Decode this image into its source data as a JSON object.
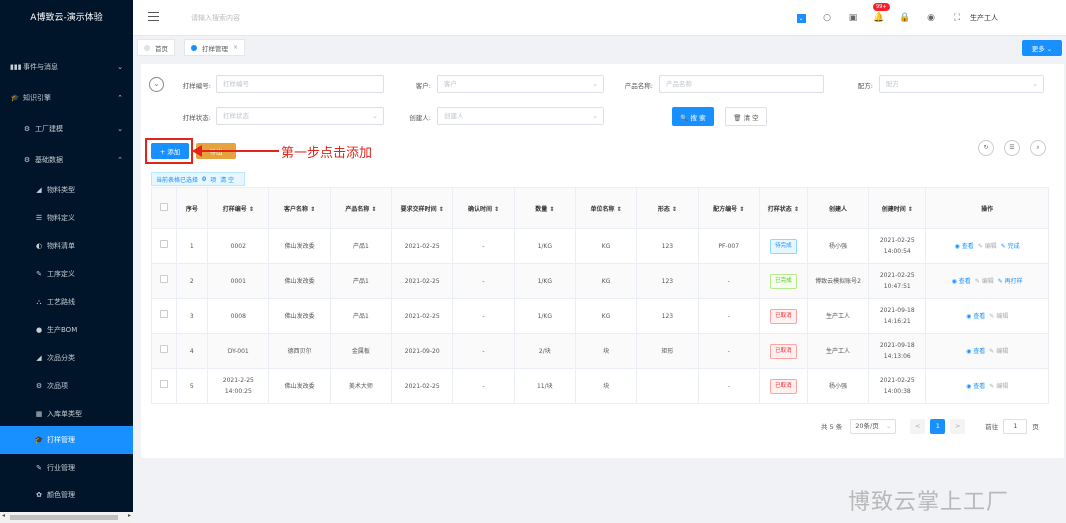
{
  "app": {
    "title": "A博致云-演示体验"
  },
  "sidebar": {
    "items": [
      {
        "label": "事件与消息",
        "icon": "▮▮▮",
        "chevron": "⌄"
      },
      {
        "label": "知识引擎",
        "icon": "🎓",
        "chevron": "⌃"
      },
      {
        "label": "工厂建模",
        "icon": "⚙",
        "chevron": "⌄"
      },
      {
        "label": "基础数据",
        "icon": "⚙",
        "chevron": "⌃"
      },
      {
        "label": "物料类型",
        "icon": "◢"
      },
      {
        "label": "物料定义",
        "icon": "☰"
      },
      {
        "label": "物料清单",
        "icon": "◐"
      },
      {
        "label": "工序定义",
        "icon": "✎"
      },
      {
        "label": "工艺路线",
        "icon": "⛬"
      },
      {
        "label": "生产BOM",
        "icon": "●"
      },
      {
        "label": "次品分类",
        "icon": "◢"
      },
      {
        "label": "次品项",
        "icon": "⚙"
      },
      {
        "label": "入库单类型",
        "icon": "▦"
      },
      {
        "label": "打样管理",
        "icon": "🎓"
      },
      {
        "label": "行业管理",
        "icon": "✎"
      },
      {
        "label": "颜色管理",
        "icon": "✿"
      }
    ]
  },
  "header": {
    "search_placeholder": "请输入搜索内容",
    "badge": "99+",
    "user": "生产工人"
  },
  "tabs": [
    {
      "label": "首页"
    },
    {
      "label": "打样管理",
      "close": "×"
    }
  ],
  "more_label": "更多 ⌄",
  "filters": {
    "order_no_label": "打样编号:",
    "order_no_ph": "打样编号",
    "customer_label": "客户:",
    "customer_ph": "客户",
    "product_label": "产品名称:",
    "product_ph": "产品名称",
    "formula_label": "配方:",
    "formula_ph": "配方",
    "status_label": "打样状态:",
    "status_ph": "打样状态",
    "creator_label": "创建人:",
    "creator_ph": "创建人"
  },
  "buttons": {
    "search": "🔍 搜 索",
    "clear": "🗑 清 空",
    "add": "+ 添加",
    "export": "导出"
  },
  "annotation": "第一步点击添加",
  "selection": {
    "prefix": "当前表格已选择",
    "count": "0",
    "unit": "项",
    "clear": "清 空"
  },
  "table": {
    "headers": [
      "",
      "序号",
      "打样编号 ⇕",
      "客户名称 ⇕",
      "产品名称 ⇕",
      "要求交样时间 ⇕",
      "确认时间 ⇕",
      "数量 ⇕",
      "单位名称 ⇕",
      "形态 ⇕",
      "配方编号 ⇕",
      "打样状态 ⇕",
      "创建人",
      "创建时间 ⇕",
      "操作"
    ],
    "rows": [
      {
        "no": "1",
        "code": "0002",
        "customer": "佛山发改委",
        "product": "产品1",
        "due": "2021-02-25",
        "confirm": "-",
        "qty": "1/KG",
        "unit": "KG",
        "form": "123",
        "formula": "PF-007",
        "status": "待完成",
        "status_color": "blue",
        "creator": "杨小强",
        "created": "2021-02-25 14:00:54",
        "ops": [
          "◉ 查看",
          "✎ 编辑",
          "✎ 完成"
        ],
        "op_colors": [
          "blue",
          "grey",
          "blue"
        ]
      },
      {
        "no": "2",
        "code": "0001",
        "customer": "佛山发改委",
        "product": "产品1",
        "due": "2021-02-25",
        "confirm": "-",
        "qty": "1/KG",
        "unit": "KG",
        "form": "123",
        "formula": "-",
        "status": "已完成",
        "status_color": "green",
        "creator": "博致云模拟账号2",
        "created": "2021-02-25 10:47:51",
        "ops": [
          "◉ 查看",
          "✎ 编辑",
          "✎ 再打样"
        ],
        "op_colors": [
          "blue",
          "grey",
          "blue"
        ]
      },
      {
        "no": "3",
        "code": "0008",
        "customer": "佛山发改委",
        "product": "产品1",
        "due": "2021-02-25",
        "confirm": "-",
        "qty": "1/KG",
        "unit": "KG",
        "form": "123",
        "formula": "-",
        "status": "已取消",
        "status_color": "red",
        "creator": "生产工人",
        "created": "2021-09-18 14:16:21",
        "ops": [
          "◉ 查看",
          "✎ 编辑"
        ],
        "op_colors": [
          "blue",
          "grey"
        ]
      },
      {
        "no": "4",
        "code": "DY-001",
        "customer": "德西贝尔",
        "product": "金属板",
        "due": "2021-09-20",
        "confirm": "-",
        "qty": "2/块",
        "unit": "块",
        "form": "矩形",
        "formula": "-",
        "status": "已取消",
        "status_color": "red",
        "creator": "生产工人",
        "created": "2021-09-18 14:13:06",
        "ops": [
          "◉ 查看",
          "✎ 编辑"
        ],
        "op_colors": [
          "blue",
          "grey"
        ]
      },
      {
        "no": "5",
        "code": "2021-2-25 14:00:25",
        "customer": "佛山发改委",
        "product": "美术大师",
        "due": "2021-02-25",
        "confirm": "-",
        "qty": "11/块",
        "unit": "块",
        "form": "",
        "formula": "-",
        "status": "已取消",
        "status_color": "red",
        "creator": "杨小强",
        "created": "2021-02-25 14:00:38",
        "ops": [
          "◉ 查看",
          "✎ 编辑"
        ],
        "op_colors": [
          "blue",
          "grey"
        ]
      }
    ]
  },
  "pagination": {
    "total": "共 5 条",
    "per_page": "20条/页",
    "prev": "<",
    "page": "1",
    "next": ">",
    "goto": "前往",
    "goto_value": "1",
    "page_unit": "页"
  },
  "watermark": "博致云掌上工厂",
  "colors": {
    "sidebar_bg": "#001529",
    "accent": "#1890ff",
    "annotation_red": "#e1251b"
  }
}
